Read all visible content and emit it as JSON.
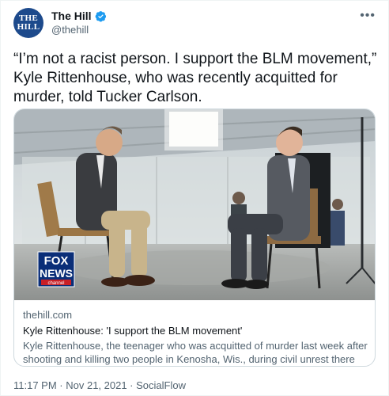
{
  "author": {
    "avatar_line1": "THE",
    "avatar_line2": "HILL",
    "display_name": "The Hill",
    "handle": "@thehill"
  },
  "tweet": {
    "text": "“I’m not a racist person. I support the BLM movement,” Kyle Rittenhouse, who was recently acquitted for murder, told Tucker Carlson."
  },
  "link_card": {
    "network_logo_line1": "FOX",
    "network_logo_line2": "NEWS",
    "network_logo_line3": "channel",
    "domain": "thehill.com",
    "title": "Kyle Rittenhouse: 'I support the BLM movement'",
    "description": "Kyle Rittenhouse, the teenager who was acquitted of murder last week after shooting and killing two people in Kenosha, Wis., during civil unrest there last ..."
  },
  "meta": {
    "timestamp": "11:17 PM · Nov 21, 2021 · SocialFlow"
  },
  "icons": {
    "verified": "verified-badge-icon",
    "more": "more-options-icon"
  },
  "colors": {
    "verified": "#1d9bf0",
    "secondary_text": "#536471",
    "avatar_bg": "#1d4a8c"
  }
}
